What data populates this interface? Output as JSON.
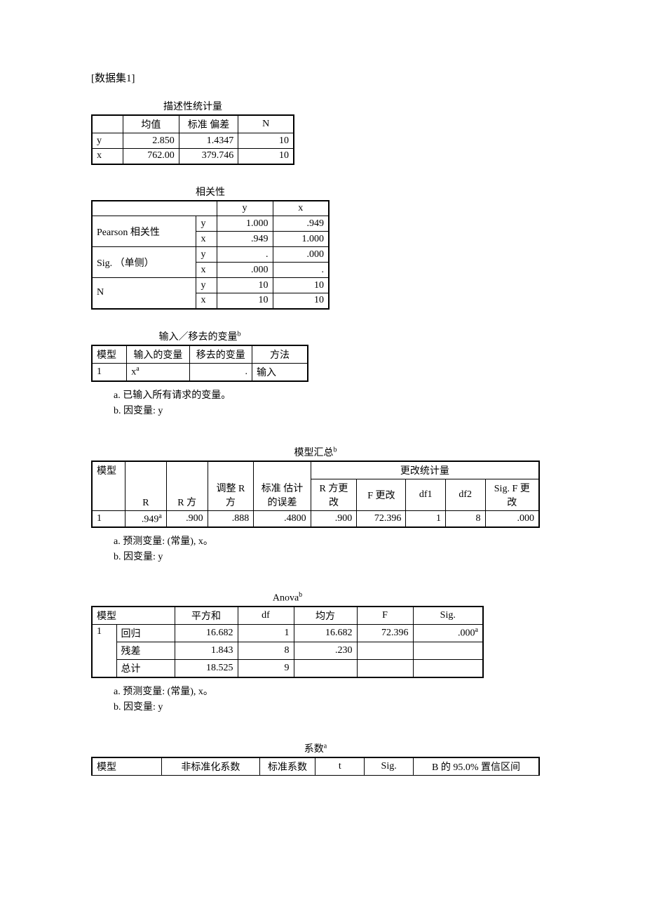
{
  "dataset_label": "[数据集1]",
  "desc_stats": {
    "title": "描述性统计量",
    "headers": {
      "mean": "均值",
      "std": "标准 偏差",
      "n": "N"
    },
    "rows": [
      {
        "var": "y",
        "mean": "2.850",
        "std": "1.4347",
        "n": "10"
      },
      {
        "var": "x",
        "mean": "762.00",
        "std": "379.746",
        "n": "10"
      }
    ]
  },
  "correlations": {
    "title": "相关性",
    "col_y": "y",
    "col_x": "x",
    "groups": [
      {
        "label": "Pearson 相关性",
        "rows": [
          {
            "var": "y",
            "y": "1.000",
            "x": ".949"
          },
          {
            "var": "x",
            "y": ".949",
            "x": "1.000"
          }
        ]
      },
      {
        "label": "Sig. （单侧）",
        "rows": [
          {
            "var": "y",
            "y": ".",
            "x": ".000"
          },
          {
            "var": "x",
            "y": ".000",
            "x": "."
          }
        ]
      },
      {
        "label": "N",
        "rows": [
          {
            "var": "y",
            "y": "10",
            "x": "10"
          },
          {
            "var": "x",
            "y": "10",
            "x": "10"
          }
        ]
      }
    ]
  },
  "vars_entered": {
    "title": "输入／移去的变量",
    "title_sup": "b",
    "headers": {
      "model": "模型",
      "entered": "输入的变量",
      "removed": "移去的变量",
      "method": "方法"
    },
    "row": {
      "model": "1",
      "entered": "x",
      "entered_sup": "a",
      "removed": ".",
      "method": "输入"
    },
    "footnotes": [
      "a. 已输入所有请求的变量。",
      "b. 因变量: y"
    ]
  },
  "model_summary": {
    "title": "模型汇总",
    "title_sup": "b",
    "headers": {
      "model": "模型",
      "r": "R",
      "rsq": "R 方",
      "adjrsq": "调整 R 方",
      "stderr": "标准 估计的误差",
      "change_stats": "更改统计量",
      "rsqchg": "R 方更改",
      "fchg": "F 更改",
      "df1": "df1",
      "df2": "df2",
      "sigfchg": "Sig. F 更改"
    },
    "row": {
      "model": "1",
      "r": ".949",
      "r_sup": "a",
      "rsq": ".900",
      "adjrsq": ".888",
      "stderr": ".4800",
      "rsqchg": ".900",
      "fchg": "72.396",
      "df1": "1",
      "df2": "8",
      "sigfchg": ".000"
    },
    "footnotes": [
      "a. 预测变量: (常量), x。",
      "b. 因变量: y"
    ]
  },
  "anova": {
    "title": "Anova",
    "title_sup": "b",
    "headers": {
      "model": "模型",
      "ss": "平方和",
      "df": "df",
      "ms": "均方",
      "f": "F",
      "sig": "Sig."
    },
    "rows": [
      {
        "model": "1",
        "label": "回归",
        "ss": "16.682",
        "df": "1",
        "ms": "16.682",
        "f": "72.396",
        "sig": ".000",
        "sig_sup": "a"
      },
      {
        "model": "",
        "label": "残差",
        "ss": "1.843",
        "df": "8",
        "ms": ".230",
        "f": "",
        "sig": ""
      },
      {
        "model": "",
        "label": "总计",
        "ss": "18.525",
        "df": "9",
        "ms": "",
        "f": "",
        "sig": ""
      }
    ],
    "footnotes": [
      "a. 预测变量: (常量), x。",
      "b. 因变量: y"
    ]
  },
  "coefficients": {
    "title": "系数",
    "title_sup": "a",
    "headers": {
      "model": "模型",
      "unstd": "非标准化系数",
      "std": "标准系数",
      "t": "t",
      "sig": "Sig.",
      "ci": "B 的 95.0% 置信区间"
    }
  }
}
